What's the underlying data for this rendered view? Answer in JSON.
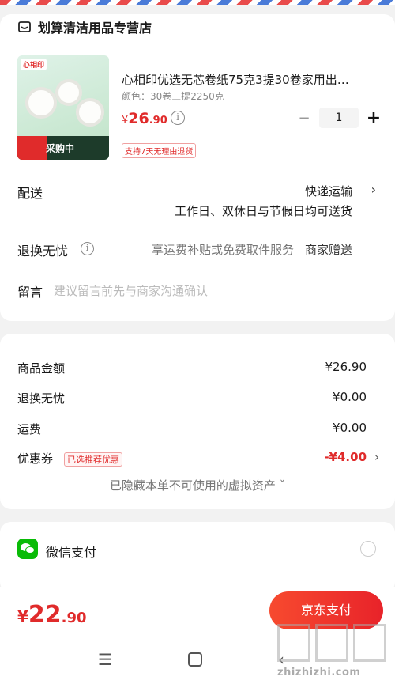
{
  "store": {
    "name": "划算清洁用品专营店",
    "icon": "store-icon"
  },
  "product": {
    "title": "心相印优选无芯卷纸75克3提30卷家用出…",
    "spec": "颜色：30卷三提2250克",
    "price_currency": "¥",
    "price_int": "26",
    "price_dec": ".90",
    "return_tag": "支持7天无理由退货",
    "thumb_brand": "心相印",
    "thumb_status": "采购中",
    "quantity": "1",
    "minus": "−",
    "plus": "+"
  },
  "delivery": {
    "label": "配送",
    "method": "快递运输",
    "note": "工作日、双休日与节假日均可送货"
  },
  "returns": {
    "label": "退换无忧",
    "desc": "享运费补贴或免费取件服务",
    "gift": "商家赠送"
  },
  "memo": {
    "label": "留言",
    "placeholder": "建议留言前先与商家沟通确认"
  },
  "summary": {
    "goods_label": "商品金额",
    "goods_value": "¥26.90",
    "returns_label": "退换无忧",
    "returns_value": "¥0.00",
    "shipping_label": "运费",
    "shipping_value": "¥0.00",
    "coupon_label": "优惠券",
    "coupon_tag": "已选推荐优惠",
    "coupon_value": "-¥4.00",
    "hidden_assets": "已隐藏本单不可使用的虚拟资产 ˇ"
  },
  "payment": {
    "method": "微信支付",
    "icon": "wechat-icon"
  },
  "total": {
    "currency": "¥",
    "int": "22",
    "dec": ".90"
  },
  "pay_button": "京东支付",
  "nav": {
    "menu": "☰",
    "back": "‹"
  },
  "watermark": {
    "text": "zhizhizhi.com"
  },
  "colors": {
    "accent": "#e02b2b",
    "wechat": "#09bb07",
    "pay_button": "#f0322c"
  }
}
